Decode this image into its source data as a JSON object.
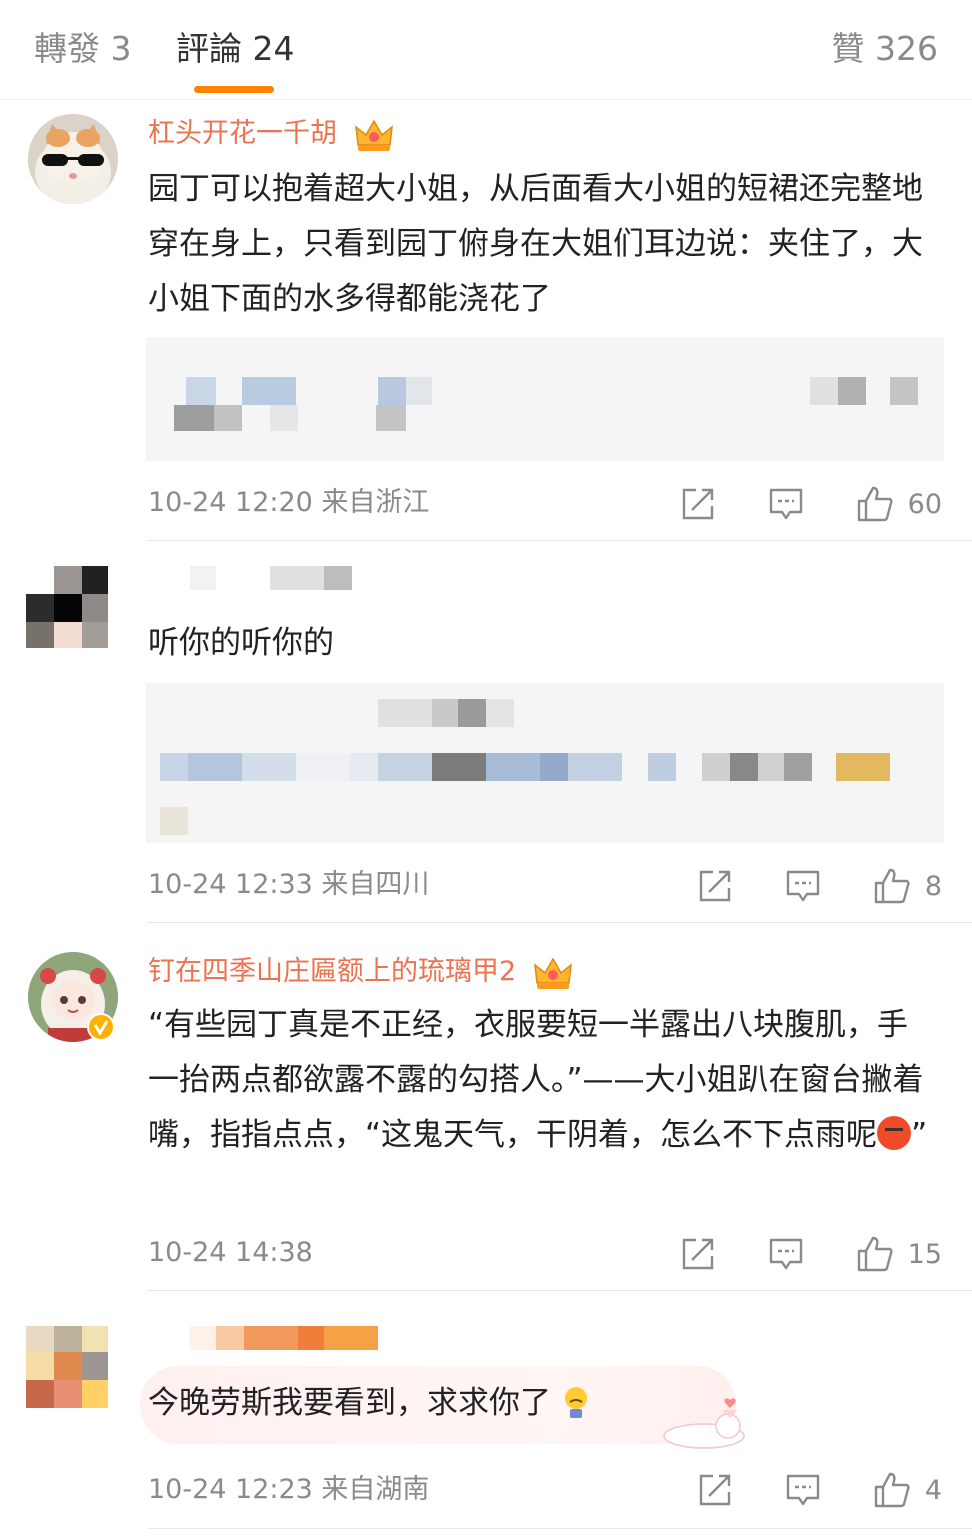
{
  "tabs": {
    "repost": "轉發 3",
    "comments": "評論 24",
    "likes": "贊 326"
  },
  "colors": {
    "accent": "#ff8200",
    "username": "#eb7350",
    "meta": "#8a8a8a"
  },
  "comments": [
    {
      "username": "杠头开花一千胡",
      "text": "园丁可以抱着超大小姐，从后面看大小姐的短裙还完整地穿在身上，只看到园丁俯身在大姐们耳边说：夹住了，大小姐下面的水多得都能浇花了",
      "meta": "10-24 12:20 来自浙江",
      "likes": "60",
      "avatar": "cat-with-sunglasses"
    },
    {
      "username": "",
      "text": "听你的听你的",
      "meta": "10-24 12:33 来自四川",
      "likes": "8",
      "avatar": "pixelated"
    },
    {
      "username": "钉在四季山庄匾额上的琉璃甲2",
      "text": "“有些园丁真是不正经，衣服要短一半露出八块腹肌，手一抬两点都欲露不露的勾搭人。”——大小姐趴在窗台撇着嘴，指指点点，“这鬼天气，干阴着，怎么不下点雨呢",
      "text_end": "”",
      "meta": "10-24 14:38",
      "likes": "15",
      "avatar": "anime-character"
    },
    {
      "username": "",
      "text": "今晚劳斯我要看到，求求你了",
      "meta": "10-24 12:23 来自湖南",
      "likes": "4",
      "avatar": "pixelated"
    }
  ],
  "icons": [
    "repost-icon",
    "reply-icon",
    "like-icon",
    "crown-icon",
    "angry-emoji-icon",
    "sad-emoji-icon"
  ]
}
